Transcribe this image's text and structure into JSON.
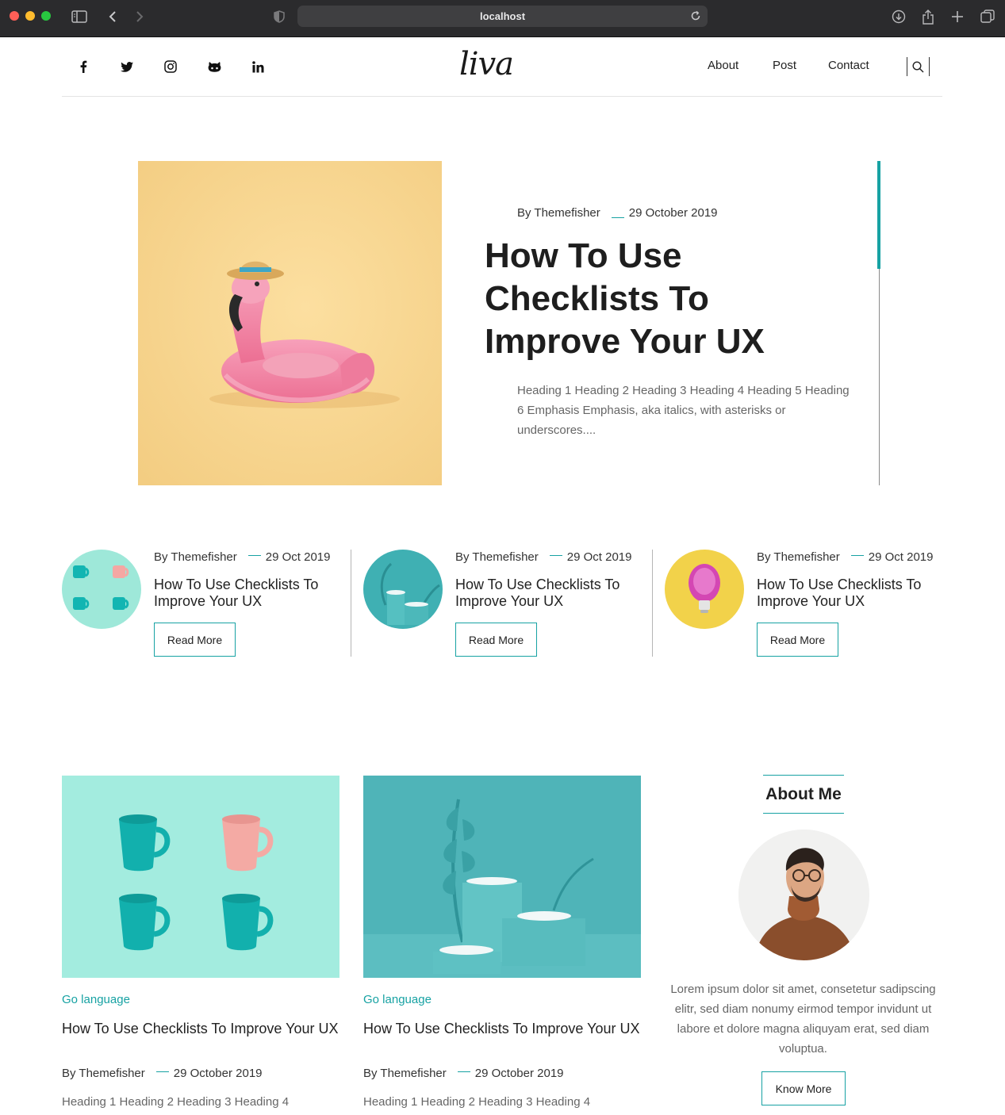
{
  "browser": {
    "url": "localhost"
  },
  "header": {
    "logo": "liva",
    "social": [
      "facebook-icon",
      "twitter-icon",
      "instagram-icon",
      "github-icon",
      "linkedin-icon"
    ],
    "nav": {
      "about": "About",
      "post": "Post",
      "contact": "Contact"
    }
  },
  "hero": {
    "author": "By Themefisher",
    "date": "29 October 2019",
    "title": "How To Use Checklists To Improve Your UX",
    "excerpt": "Heading 1 Heading 2 Heading 3 Heading 4 Heading 5 Heading 6 Emphasis Emphasis, aka italics, with asterisks or underscores...."
  },
  "small_posts": [
    {
      "author": "By Themefisher",
      "date": "29 Oct 2019",
      "title": "How To Use Checklists To Improve Your UX",
      "button": "Read More"
    },
    {
      "author": "By Themefisher",
      "date": "29 Oct 2019",
      "title": "How To Use Checklists To Improve Your UX",
      "button": "Read More"
    },
    {
      "author": "By Themefisher",
      "date": "29 Oct 2019",
      "title": "How To Use Checklists To Improve Your UX",
      "button": "Read More"
    }
  ],
  "cards": [
    {
      "category": "Go language",
      "title": "How To Use Checklists To Improve Your UX",
      "author": "By Themefisher",
      "date": "29 October 2019",
      "excerpt": "Heading 1 Heading 2 Heading 3 Heading 4"
    },
    {
      "category": "Go language",
      "title": "How To Use Checklists To Improve Your UX",
      "author": "By Themefisher",
      "date": "29 October 2019",
      "excerpt": "Heading 1 Heading 2 Heading 3 Heading 4"
    }
  ],
  "about": {
    "title": "About Me",
    "text": "Lorem ipsum dolor sit amet, consetetur sadipscing elitr, sed diam nonumy eirmod tempor invidunt ut labore et dolore magna aliquyam erat, sed diam voluptua.",
    "button": "Know More"
  },
  "colors": {
    "accent": "#17a2a3"
  }
}
